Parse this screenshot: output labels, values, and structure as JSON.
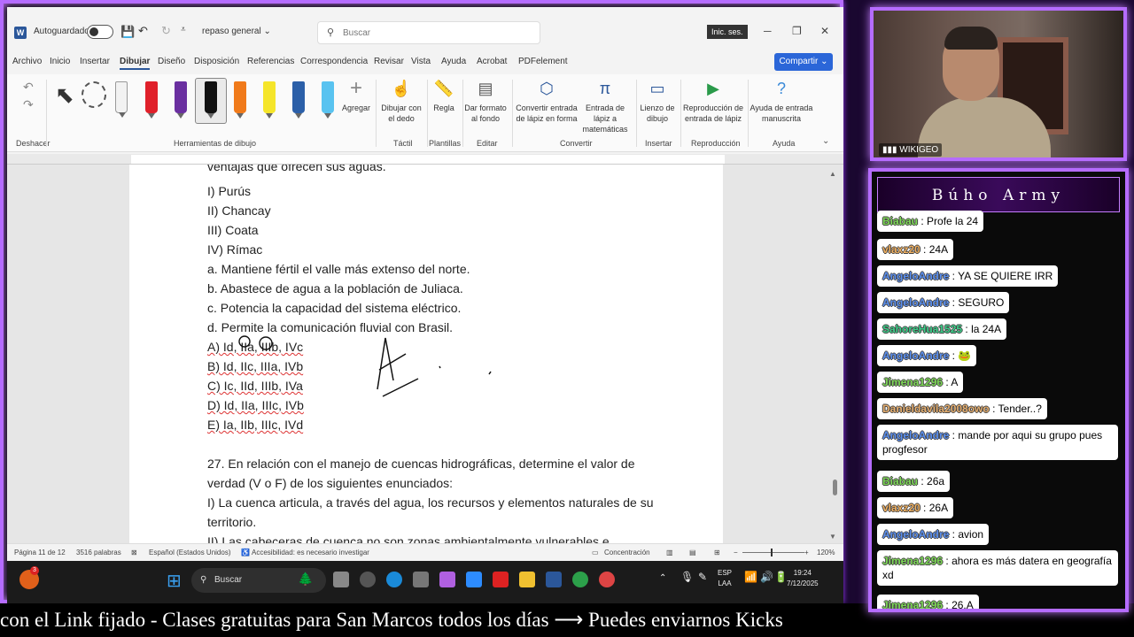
{
  "word": {
    "autosave_label": "Autoguardado",
    "doc_name": "repaso general",
    "search_placeholder": "Buscar",
    "signin": "Inic. ses.",
    "menu": [
      "Archivo",
      "Inicio",
      "Insertar",
      "Dibujar",
      "Diseño",
      "Disposición",
      "Referencias",
      "Correspondencia",
      "Revisar",
      "Vista",
      "Ayuda",
      "Acrobat",
      "PDFelement"
    ],
    "share": "Compartir",
    "ribbon": {
      "undo_group": "Deshacer",
      "tools_group": "Herramientas de dibujo",
      "add_label": "Agregar",
      "draw_finger": "Dibujar con el dedo",
      "touch_group": "Táctil",
      "ruler": "Regla",
      "templates_group": "Plantillas",
      "format_bg": "Dar formato al fondo",
      "edit_group": "Editar",
      "ink_shape": "Convertir entrada de lápiz en forma",
      "ink_math": "Entrada de lápiz a matemáticas",
      "convert_group": "Convertir",
      "canvas": "Lienzo de dibujo",
      "insert_group": "Insertar",
      "replay": "Reproducción de entrada de lápiz",
      "replay_group": "Reproducción",
      "ink_help": "Ayuda de entrada manuscrita",
      "help_group": "Ayuda"
    },
    "pen_colors": [
      "#f2f2f2",
      "#e0202a",
      "#6a2fa0",
      "#111111",
      "#f07a1a",
      "#f5e52a",
      "#2b5fa8",
      "#59c3f0"
    ],
    "doc_lines": [
      "ventajas que ofrecen sus aguas.",
      "I) Purús",
      "II) Chancay",
      "III) Coata",
      "IV) Rímac",
      "a. Mantiene fértil el valle más extenso del norte.",
      "b. Abastece de agua a la población de Juliaca.",
      "c. Potencia la capacidad del sistema eléctrico.",
      "d. Permite la comunicación fluvial con Brasil.",
      "A) Id, IIa, IIIb, IVc",
      "B) Id, IIc, IIIa, IVb",
      "C) Ic, IId, IIIb, IVa",
      "D) Id, IIa, IIIc, IVb",
      "E) Ia, IIb, IIIc, IVd",
      "27. En relación con el manejo de cuencas hidrográficas, determine el valor de",
      "verdad (V o F) de los siguientes enunciados:",
      "I) La cuenca articula, a través del agua, los recursos y elementos naturales de su",
      "territorio.",
      "II) Las cabeceras de cuenca no son zonas ambientalmente vulnerables e"
    ],
    "status": {
      "page": "Página 11 de 12",
      "words": "3516 palabras",
      "lang": "Español (Estados Unidos)",
      "access": "Accesibilidad: es necesario investigar",
      "focus": "Concentración",
      "zoom": "120%"
    }
  },
  "taskbar": {
    "search": "Buscar",
    "lang": "ESP",
    "layout": "LAA",
    "time": "19:24",
    "date": "7/12/2025",
    "notif": "3"
  },
  "ticker": "con el Link fijado  -  Clases gratuitas para San Marcos todos los días  ⟶  Puedes enviarnos Kicks",
  "cam_label": "WIKIGEO",
  "chat": {
    "title": "Búho Army",
    "messages": [
      {
        "user": "Biabau",
        "text": "Profe la 24",
        "color": "#7ed957"
      },
      {
        "user": "vlaxz20",
        "text": "24A",
        "color": "#f0b060"
      },
      {
        "user": "AngeloAndre",
        "text": "YA SE QUIERE IRR",
        "color": "#5a8ff0"
      },
      {
        "user": "AngeloAndre",
        "text": "SEGURO",
        "color": "#5a8ff0"
      },
      {
        "user": "SahoreHua1525",
        "text": "la 24A",
        "color": "#3ccf8a"
      },
      {
        "user": "AngeloAndre",
        "text": "🐸",
        "color": "#5a8ff0"
      },
      {
        "user": "Jimena1296",
        "text": "A",
        "color": "#7ed957"
      },
      {
        "user": "Danieldavila2008owo",
        "text": "Tender..?",
        "color": "#e8b070"
      },
      {
        "user": "AngeloAndre",
        "text": "mande por aqui su grupo pues progfesor",
        "color": "#5a8ff0"
      },
      {
        "user": "Biabau",
        "text": "26a",
        "color": "#7ed957"
      },
      {
        "user": "vlaxz20",
        "text": "26A",
        "color": "#f0b060"
      },
      {
        "user": "AngeloAndre",
        "text": "avion",
        "color": "#5a8ff0"
      },
      {
        "user": "Jimena1296",
        "text": "ahora es más datera en geografía xd",
        "color": "#7ed957"
      },
      {
        "user": "Jimena1296",
        "text": "26.A",
        "color": "#7ed957"
      }
    ]
  }
}
